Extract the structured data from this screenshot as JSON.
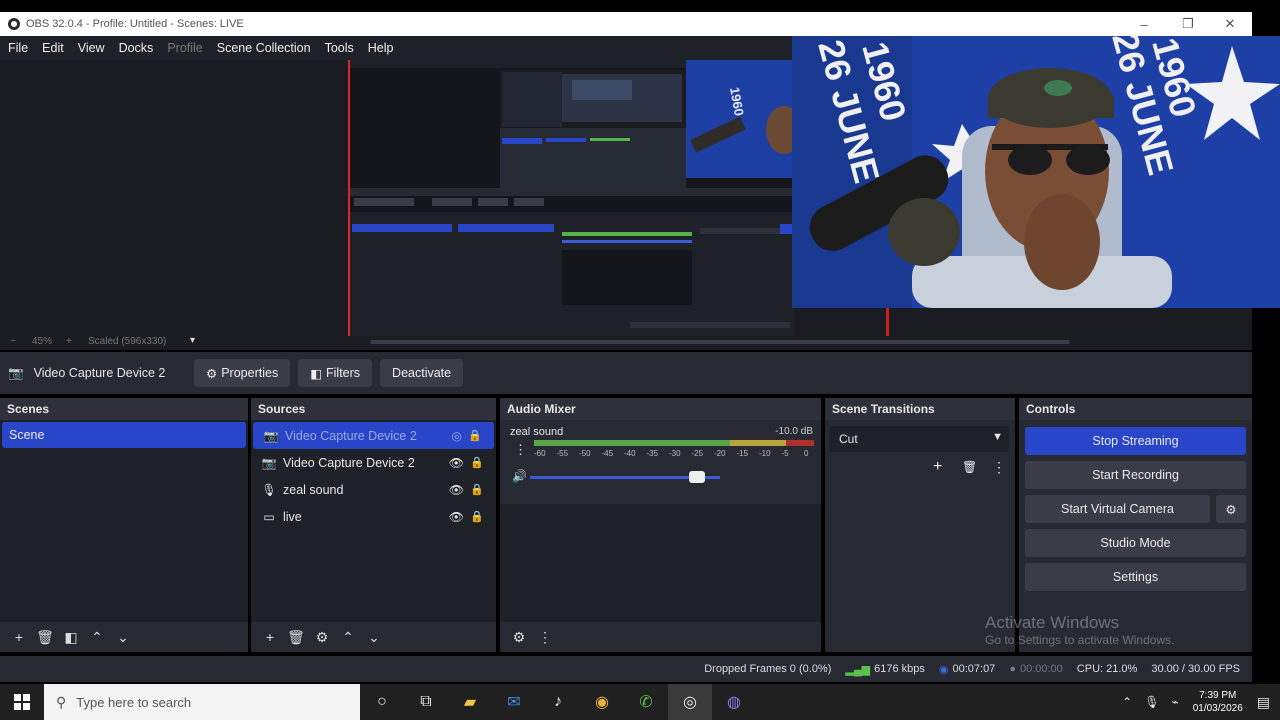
{
  "window": {
    "title": "OBS 32.0.4 - Profile: Untitled - Scenes: LIVE",
    "minimize": "–",
    "maximize": "❐",
    "close": "✕"
  },
  "menu": [
    "File",
    "Edit",
    "View",
    "Docks",
    "Profile",
    "Scene Collection",
    "Tools",
    "Help"
  ],
  "preview": {
    "zoom": "45%",
    "scale": "Scaled (596x330)",
    "cam_flag_text_1": "1960",
    "cam_flag_text_2": "26 JUNE"
  },
  "source_toolbar": {
    "source_name": "Video Capture Device 2",
    "properties": "Properties",
    "filters": "Filters",
    "deactivate": "Deactivate"
  },
  "scenes": {
    "title": "Scenes",
    "items": [
      "Scene"
    ]
  },
  "sources": {
    "title": "Sources",
    "items": [
      {
        "label": "Video Capture Device 2",
        "icon": "camera-icon"
      },
      {
        "label": "Video Capture Device 2",
        "icon": "camera-icon"
      },
      {
        "label": "zeal sound",
        "icon": "microphone-icon"
      },
      {
        "label": "live",
        "icon": "monitor-icon"
      }
    ]
  },
  "mixer": {
    "title": "Audio Mixer",
    "channel": "zeal sound",
    "level": "-10.0 dB",
    "ticks": [
      "-60",
      "-55",
      "-50",
      "-45",
      "-40",
      "-35",
      "-30",
      "-25",
      "-20",
      "-15",
      "-10",
      "-5",
      "0"
    ],
    "volume_fraction": 0.88
  },
  "transitions": {
    "title": "Scene Transitions",
    "selected": "Cut"
  },
  "controls": {
    "title": "Controls",
    "stop_streaming": "Stop Streaming",
    "start_recording": "Start Recording",
    "start_virtual_camera": "Start Virtual Camera",
    "studio_mode": "Studio Mode",
    "settings": "Settings"
  },
  "status": {
    "dropped": "Dropped Frames 0 (0.0%)",
    "bitrate": "6176 kbps",
    "stream_time": "00:07:07",
    "rec_time": "00:00:00",
    "cpu": "CPU: 21.0%",
    "fps": "30.00 / 30.00 FPS"
  },
  "watermark": {
    "line1": "Activate Windows",
    "line2": "Go to Settings to activate Windows."
  },
  "taskbar": {
    "search_placeholder": "Type here to search",
    "time": "7:39 PM",
    "date": "01/03/2026"
  },
  "colors": {
    "accent": "#2a46c8",
    "panel": "#272a33",
    "dark": "#1f2128",
    "live_red": "#d42a2a"
  }
}
